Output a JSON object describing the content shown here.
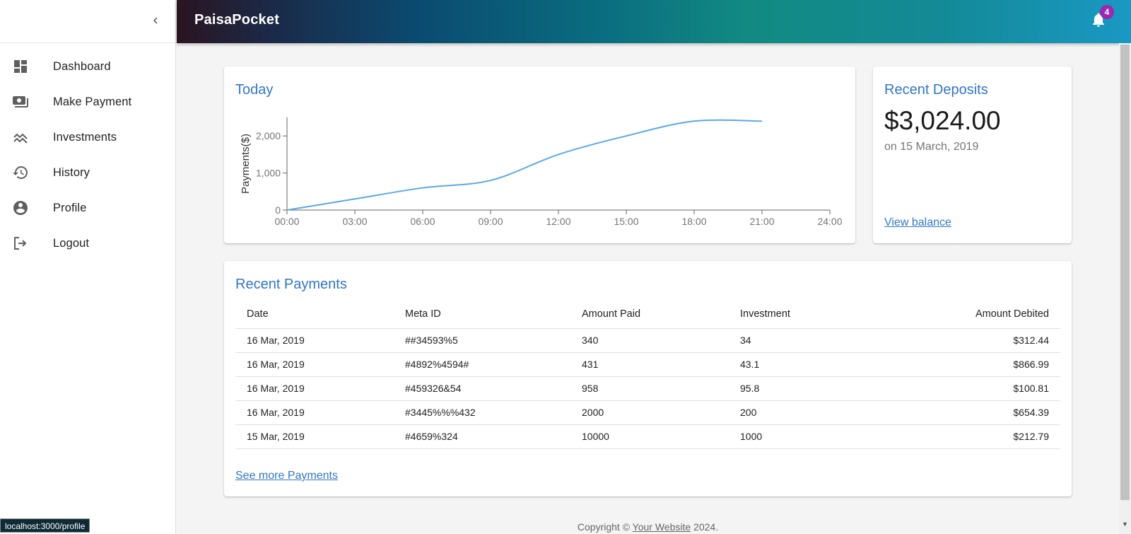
{
  "app": {
    "title": "PaisaPocket"
  },
  "notifications": {
    "count": "4"
  },
  "sidebar": {
    "items": [
      {
        "label": "Dashboard",
        "icon": "dashboard-icon"
      },
      {
        "label": "Make Payment",
        "icon": "payments-icon"
      },
      {
        "label": "Investments",
        "icon": "trending-icon"
      },
      {
        "label": "History",
        "icon": "history-icon"
      },
      {
        "label": "Profile",
        "icon": "account-circle-icon"
      },
      {
        "label": "Logout",
        "icon": "logout-icon"
      }
    ]
  },
  "today": {
    "title": "Today"
  },
  "chart_data": {
    "type": "line",
    "title": "Today",
    "xlabel": "",
    "ylabel": "Payments($)",
    "x_ticks": [
      "00:00",
      "03:00",
      "06:00",
      "09:00",
      "12:00",
      "15:00",
      "18:00",
      "21:00",
      "24:00"
    ],
    "y_ticks": [
      "0",
      "1,000",
      "2,000"
    ],
    "xlim": [
      0,
      24
    ],
    "ylim": [
      0,
      2500
    ],
    "series": [
      {
        "x": [
          0,
          3,
          6,
          9,
          12,
          15,
          18,
          21
        ],
        "values": [
          0,
          300,
          600,
          800,
          1500,
          2000,
          2400,
          2400
        ]
      }
    ],
    "color": "#5aa9e6",
    "grid": false
  },
  "deposits": {
    "title": "Recent Deposits",
    "amount": "$3,024.00",
    "date": "on 15 March, 2019",
    "link": "View balance"
  },
  "payments": {
    "title": "Recent Payments",
    "columns": [
      "Date",
      "Meta ID",
      "Amount Paid",
      "Investment",
      "Amount Debited"
    ],
    "rows": [
      [
        "16 Mar, 2019",
        "##34593%5",
        "340",
        "34",
        "$312.44"
      ],
      [
        "16 Mar, 2019",
        "#4892%4594#",
        "431",
        "43.1",
        "$866.99"
      ],
      [
        "16 Mar, 2019",
        "#459326&54",
        "958",
        "95.8",
        "$100.81"
      ],
      [
        "16 Mar, 2019",
        "#3445%%%432",
        "2000",
        "200",
        "$654.39"
      ],
      [
        "15 Mar, 2019",
        "#4659%324",
        "10000",
        "1000",
        "$212.79"
      ]
    ],
    "link": "See more Payments"
  },
  "footer": {
    "prefix": "Copyright ©",
    "link": "Your Website",
    "suffix": "2024."
  },
  "status_bar": {
    "url": "localhost:3000/profile"
  },
  "colors": {
    "accent": "#3176c5",
    "badge": "#9c27b0"
  }
}
